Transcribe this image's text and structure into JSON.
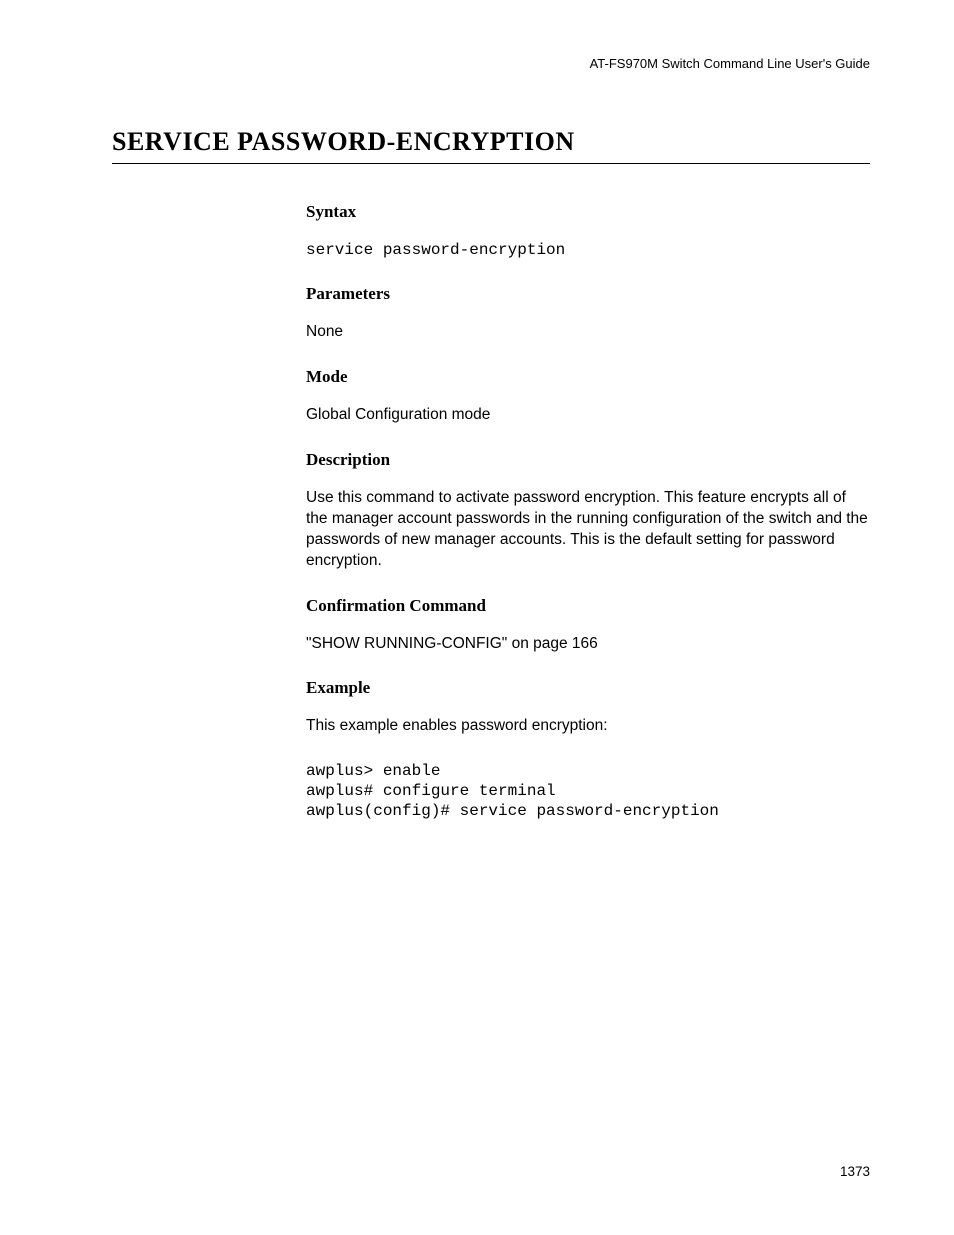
{
  "header": {
    "guide_title": "AT-FS970M Switch Command Line User's Guide"
  },
  "page": {
    "title": "SERVICE PASSWORD-ENCRYPTION",
    "number": "1373"
  },
  "sections": {
    "syntax": {
      "heading": "Syntax",
      "code": "service password-encryption"
    },
    "parameters": {
      "heading": "Parameters",
      "text": "None"
    },
    "mode": {
      "heading": "Mode",
      "text": "Global Configuration mode"
    },
    "description": {
      "heading": "Description",
      "text": "Use this command to activate password encryption. This feature encrypts all of the manager account passwords in the running configuration of the switch and the passwords of new manager accounts. This is the default setting for password encryption."
    },
    "confirmation": {
      "heading": "Confirmation Command",
      "text": "\"SHOW RUNNING-CONFIG\" on page 166"
    },
    "example": {
      "heading": "Example",
      "intro": "This example enables password encryption:",
      "code": "awplus> enable\nawplus# configure terminal\nawplus(config)# service password-encryption"
    }
  }
}
